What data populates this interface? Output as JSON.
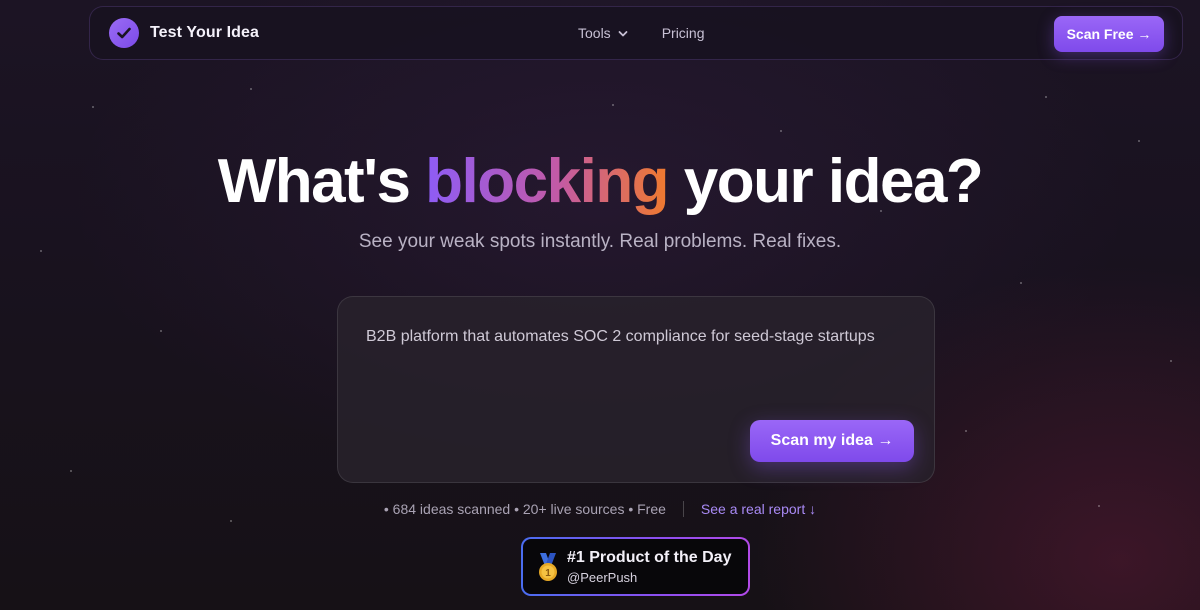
{
  "nav": {
    "brand": "Test Your Idea",
    "links": [
      {
        "label": "Tools",
        "has_dropdown": true
      },
      {
        "label": "Pricing",
        "has_dropdown": false
      }
    ],
    "cta_label": "Scan Free →"
  },
  "hero": {
    "title_prefix": "What's ",
    "title_accent": "blocking",
    "title_suffix": " your idea?",
    "subtitle": "See your weak spots instantly. Real problems. Real fixes."
  },
  "idea_form": {
    "value": "B2B platform that automates SOC 2 compliance for seed-stage startups",
    "submit_label": "Scan my idea →"
  },
  "stats": {
    "text": "• 684 ideas scanned • 20+ live sources • Free",
    "report_link": "See a real report ↓"
  },
  "badge": {
    "title": "#1 Product of the Day",
    "handle": "@PeerPush",
    "icon": "medal-icon"
  },
  "colors": {
    "accent_purple": "#8d5cf6",
    "accent_orange": "#ef7a2e",
    "link": "#a98af5"
  }
}
